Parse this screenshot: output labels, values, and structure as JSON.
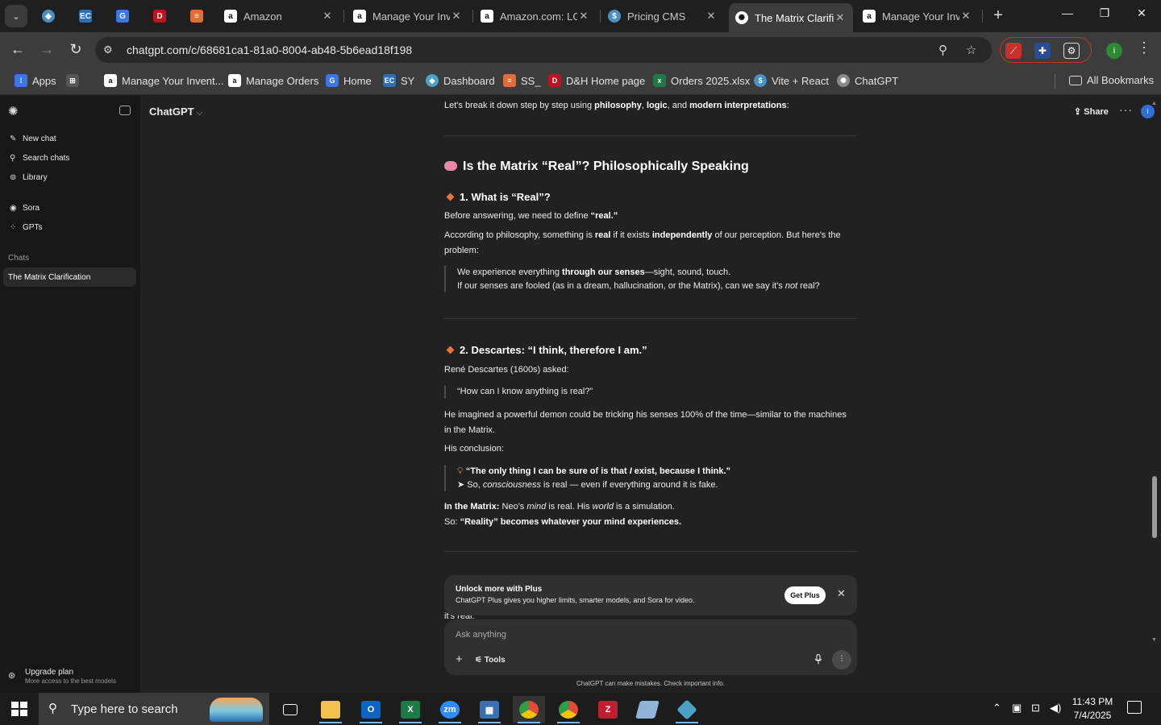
{
  "browser": {
    "tabs": [
      {
        "label": "",
        "icon": "generic-site-icon",
        "color": "#4a90c2"
      },
      {
        "label": "",
        "icon": "ec-icon",
        "color": "#2c6fb5"
      },
      {
        "label": "",
        "icon": "google-icon",
        "color": "#3b78e7"
      },
      {
        "label": "",
        "icon": "dh-icon",
        "color": "#c1121f"
      },
      {
        "label": "",
        "icon": "stack-icon",
        "color": "#e06d35"
      },
      {
        "label": "Amazon",
        "icon": "amazon-icon",
        "color": "#ffffff"
      },
      {
        "label": "Manage Your Inventory",
        "icon": "amazon-icon",
        "color": "#ffffff"
      },
      {
        "label": "Amazon.com: LG",
        "icon": "amazon-icon",
        "color": "#ffffff"
      },
      {
        "label": "Pricing CMS",
        "icon": "dollar-icon",
        "color": "#4a90c2"
      },
      {
        "label": "The Matrix Clarification",
        "icon": "chatgpt-icon",
        "color": "#ffffff"
      },
      {
        "label": "Manage Your Inventory",
        "icon": "amazon-icon",
        "color": "#ffffff"
      }
    ],
    "url": "chatgpt.com/c/68681ca1-81a0-8004-ab48-5b6ead18f198",
    "bookmarks": [
      {
        "label": "Apps",
        "icon": "apps-grid-icon",
        "color": "#3b78e7"
      },
      {
        "label": "",
        "icon": "tab-groups-icon",
        "color": "#555555"
      },
      {
        "label": "Manage Your Invent...",
        "icon": "amazon-icon",
        "color": "#ffffff"
      },
      {
        "label": "Manage Orders",
        "icon": "amazon-icon",
        "color": "#ffffff"
      },
      {
        "label": "Home",
        "icon": "google-icon",
        "color": "#3b78e7"
      },
      {
        "label": "SY",
        "icon": "ec-icon",
        "color": "#2c6fb5"
      },
      {
        "label": "Dashboard",
        "icon": "dashboard-icon",
        "color": "#4aa3c7"
      },
      {
        "label": "SS_",
        "icon": "stack-icon",
        "color": "#e06d35"
      },
      {
        "label": "D&H Home page",
        "icon": "dh-icon",
        "color": "#c1121f"
      },
      {
        "label": "Orders 2025.xlsx",
        "icon": "excel-icon",
        "color": "#1e7a45"
      },
      {
        "label": "Vite + React",
        "icon": "dollar-icon",
        "color": "#4a90c2"
      },
      {
        "label": "ChatGPT",
        "icon": "chatgpt-icon",
        "color": "#8a8a8a"
      }
    ],
    "all_bookmarks": "All Bookmarks",
    "profile_initial": "i"
  },
  "sidebar": {
    "new_chat": "New chat",
    "search_chats": "Search chats",
    "library": "Library",
    "sora": "Sora",
    "gpts": "GPTs",
    "chats_heading": "Chats",
    "active_chat": "The Matrix Clarification",
    "upgrade_title": "Upgrade plan",
    "upgrade_sub": "More access to the best models"
  },
  "header": {
    "model": "ChatGPT",
    "share": "Share",
    "avatar_initial": "i"
  },
  "message": {
    "intro_pre": "Let's break it down step by step using ",
    "intro_bold1": "philosophy",
    "intro_mid1": ", ",
    "intro_bold2": "logic",
    "intro_mid2": ", and ",
    "intro_bold3": "modern interpretations",
    "intro_post": ":",
    "h2": "Is the Matrix “Real”? Philosophically Speaking",
    "s1_title": "1. What is “Real”?",
    "s1_p1_pre": "Before answering, we need to define ",
    "s1_p1_bold": "“real.”",
    "s1_p2_pre": "According to philosophy, something is ",
    "s1_p2_bold1": "real",
    "s1_p2_mid": " if it exists ",
    "s1_p2_bold2": "independently",
    "s1_p2_post": " of our perception. But here's the problem:",
    "s1_q1_pre": "We experience everything ",
    "s1_q1_bold": "through our senses",
    "s1_q1_post": "—sight, sound, touch.",
    "s1_q2_pre": "If our senses are fooled (as in a dream, hallucination, or the Matrix), can we say it's ",
    "s1_q2_em": "not",
    "s1_q2_post": " real?",
    "s2_title": "2. Descartes: “I think, therefore I am.”",
    "s2_p1": "René Descartes (1600s) asked:",
    "s2_q1": "“How can I know anything is real?”",
    "s2_p2": "He imagined a powerful demon could be tricking his senses 100% of the time—similar to the machines in the Matrix.",
    "s2_p3": "His conclusion:",
    "s2_q2_bold_pre": "“The only thing I can be sure of is that ",
    "s2_q2_em": "I",
    "s2_q2_bold_post": " exist, because I think.”",
    "s2_q3_pre": "➤ So, ",
    "s2_q3_em": "consciousness",
    "s2_q3_post": " is real — even if everything around it is fake.",
    "s2_p4_bold": "In the Matrix:",
    "s2_p4_pre": " Neo's ",
    "s2_p4_em1": "mind",
    "s2_p4_mid": " is real. His ",
    "s2_p4_em2": "world",
    "s2_p4_post": " is a simulation.",
    "s2_p5_pre": "So: ",
    "s2_p5_bold": "“Reality” becomes whatever your mind experiences.",
    "peek": "it's real."
  },
  "banner": {
    "title": "Unlock more with Plus",
    "subtitle": "ChatGPT Plus gives you higher limits, smarter models, and Sora for video.",
    "cta": "Get Plus"
  },
  "composer": {
    "placeholder": "Ask anything",
    "tools": "Tools",
    "disclaimer": "ChatGPT can make mistakes. Check important info."
  },
  "taskbar": {
    "search_placeholder": "Type here to search",
    "time": "11:43 PM",
    "date": "7/4/2025",
    "apps": [
      {
        "icon": "task-view-icon",
        "color": "#1c1c1c"
      },
      {
        "icon": "file-explorer-icon",
        "color": "#f2c14e"
      },
      {
        "icon": "outlook-icon",
        "color": "#0a64c2"
      },
      {
        "icon": "excel-icon",
        "color": "#1e7a45"
      },
      {
        "icon": "zoom-icon",
        "color": "#2d8cff"
      },
      {
        "icon": "calculator-icon",
        "color": "#3a6fb0"
      },
      {
        "icon": "chrome-icon",
        "color": "#e14b3b"
      },
      {
        "icon": "chrome-icon",
        "color": "#e14b3b"
      },
      {
        "icon": "filezilla-icon",
        "color": "#bf1e2e"
      },
      {
        "icon": "notes-icon",
        "color": "#8fb4d8"
      },
      {
        "icon": "app-icon",
        "color": "#4aa3c7"
      }
    ]
  }
}
